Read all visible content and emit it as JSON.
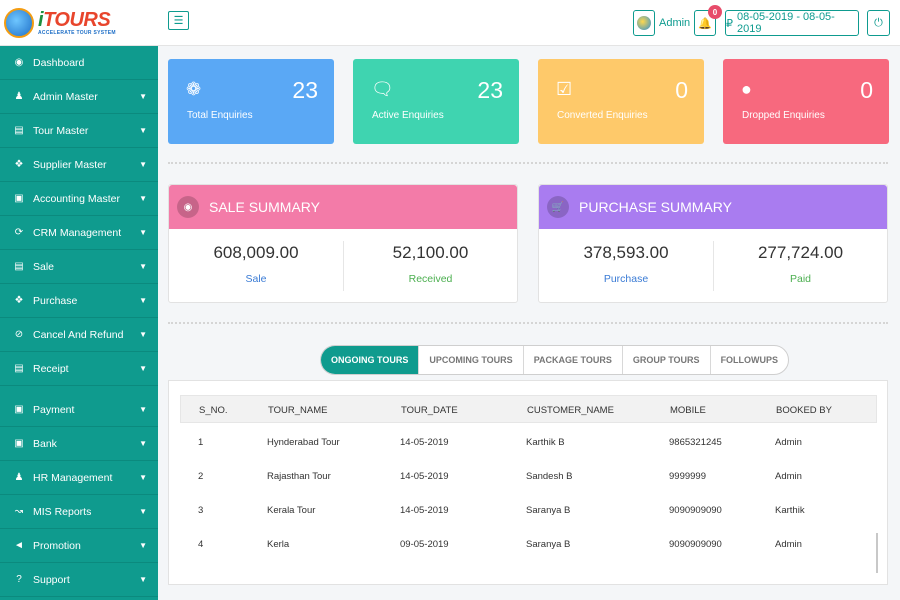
{
  "brand": {
    "name_prefix": "i",
    "name": "TOURS",
    "tagline": "ACCELERATE TOUR SYSTEM"
  },
  "header": {
    "user_name": "Admin",
    "notification_count": "0",
    "date_range": "08-05-2019 - 08-05-2019"
  },
  "sidebar": {
    "items": [
      {
        "label": "Dashboard",
        "icon": "dashboard-icon",
        "has_submenu": false
      },
      {
        "label": "Admin Master",
        "icon": "user-icon",
        "has_submenu": true
      },
      {
        "label": "Tour Master",
        "icon": "book-icon",
        "has_submenu": true
      },
      {
        "label": "Supplier Master",
        "icon": "handshake-icon",
        "has_submenu": true
      },
      {
        "label": "Accounting Master",
        "icon": "money-icon",
        "has_submenu": true
      },
      {
        "label": "CRM Management",
        "icon": "sync-icon",
        "has_submenu": true
      },
      {
        "label": "Sale",
        "icon": "card-icon",
        "has_submenu": true
      },
      {
        "label": "Purchase",
        "icon": "handshake-icon",
        "has_submenu": true
      },
      {
        "label": "Cancel And Refund",
        "icon": "ban-icon",
        "has_submenu": true
      },
      {
        "label": "Receipt",
        "icon": "file-icon",
        "has_submenu": true
      },
      {
        "label": "Payment",
        "icon": "money-icon",
        "has_submenu": true
      },
      {
        "label": "Bank",
        "icon": "money-icon",
        "has_submenu": true
      },
      {
        "label": "HR Management",
        "icon": "users-icon",
        "has_submenu": true
      },
      {
        "label": "MIS Reports",
        "icon": "chart-icon",
        "has_submenu": true
      },
      {
        "label": "Promotion",
        "icon": "megaphone-icon",
        "has_submenu": true
      },
      {
        "label": "Support",
        "icon": "question-icon",
        "has_submenu": true
      }
    ]
  },
  "stats": [
    {
      "label": "Total Enquiries",
      "value": "23",
      "color": "#5aa8f5",
      "icon": "cubes-icon"
    },
    {
      "label": "Active Enquiries",
      "value": "23",
      "color": "#3fd4b0",
      "icon": "chat-icon"
    },
    {
      "label": "Converted Enquiries",
      "value": "0",
      "color": "#fec96a",
      "icon": "check-square-icon"
    },
    {
      "label": "Dropped Enquiries",
      "value": "0",
      "color": "#f7697e",
      "icon": "drop-icon"
    }
  ],
  "sale_summary": {
    "title": "SALE SUMMARY",
    "color": "#f37ba8",
    "left_value": "608,009.00",
    "left_label": "Sale",
    "right_value": "52,100.00",
    "right_label": "Received"
  },
  "purchase_summary": {
    "title": "PURCHASE SUMMARY",
    "color": "#a97cf0",
    "left_value": "378,593.00",
    "left_label": "Purchase",
    "right_value": "277,724.00",
    "right_label": "Paid"
  },
  "tabs": [
    {
      "label": "ONGOING TOURS",
      "active": true
    },
    {
      "label": "UPCOMING TOURS",
      "active": false
    },
    {
      "label": "PACKAGE TOURS",
      "active": false
    },
    {
      "label": "GROUP TOURS",
      "active": false
    },
    {
      "label": "FOLLOWUPS",
      "active": false
    }
  ],
  "table": {
    "columns": [
      "S_NO.",
      "TOUR_NAME",
      "TOUR_DATE",
      "CUSTOMER_NAME",
      "MOBILE",
      "BOOKED BY"
    ],
    "rows": [
      [
        "1",
        "Hynderabad Tour",
        "14-05-2019",
        "Karthik B",
        "9865321245",
        "Admin"
      ],
      [
        "2",
        "Rajasthan Tour",
        "14-05-2019",
        "Sandesh B",
        "9999999",
        "Admin"
      ],
      [
        "3",
        "Kerala Tour",
        "14-05-2019",
        "Saranya B",
        "9090909090",
        "Karthik"
      ],
      [
        "4",
        "Kerla",
        "09-05-2019",
        "Saranya B",
        "9090909090",
        "Admin"
      ]
    ]
  },
  "colors": {
    "accent": "#0f9b8e",
    "sale_label": "#3a7bd5",
    "received_label": "#4caf50"
  }
}
